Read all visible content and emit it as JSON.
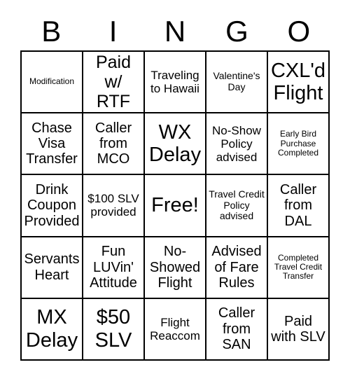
{
  "card": {
    "title": "BINGO",
    "header_letters": [
      "B",
      "I",
      "N",
      "G",
      "O"
    ],
    "columns": 5,
    "rows": 5,
    "border_color": "#000000",
    "background_color": "#ffffff",
    "text_color": "#000000",
    "cells": [
      {
        "text": "Modification",
        "size": "xs",
        "row": 1,
        "col": 1
      },
      {
        "text": "Paid w/ RTF",
        "size": "xl",
        "row": 1,
        "col": 2
      },
      {
        "text": "Traveling to Hawaii",
        "size": "m",
        "row": 1,
        "col": 3
      },
      {
        "text": "Valentine's Day",
        "size": "s",
        "row": 1,
        "col": 4
      },
      {
        "text": "CXL'd Flight",
        "size": "xxl",
        "row": 1,
        "col": 5
      },
      {
        "text": "Chase Visa Transfer",
        "size": "l",
        "row": 2,
        "col": 1
      },
      {
        "text": "Caller from MCO",
        "size": "l",
        "row": 2,
        "col": 2
      },
      {
        "text": "WX Delay",
        "size": "xxl",
        "row": 2,
        "col": 3
      },
      {
        "text": "No-Show Policy advised",
        "size": "m",
        "row": 2,
        "col": 4
      },
      {
        "text": "Early Bird Purchase Completed",
        "size": "xs",
        "row": 2,
        "col": 5
      },
      {
        "text": "Drink Coupon Provided",
        "size": "l",
        "row": 3,
        "col": 1
      },
      {
        "text": "$100 SLV provided",
        "size": "m",
        "row": 3,
        "col": 2
      },
      {
        "text": "Free!",
        "size": "xxl",
        "row": 3,
        "col": 3
      },
      {
        "text": "Travel Credit Policy advised",
        "size": "s",
        "row": 3,
        "col": 4
      },
      {
        "text": "Caller from DAL",
        "size": "l",
        "row": 3,
        "col": 5
      },
      {
        "text": "Servants Heart",
        "size": "l",
        "row": 4,
        "col": 1
      },
      {
        "text": "Fun LUVin' Attitude",
        "size": "l",
        "row": 4,
        "col": 2
      },
      {
        "text": "No-Showed Flight",
        "size": "l",
        "row": 4,
        "col": 3
      },
      {
        "text": "Advised of Fare Rules",
        "size": "l",
        "row": 4,
        "col": 4
      },
      {
        "text": "Completed Travel Credit Transfer",
        "size": "xs",
        "row": 4,
        "col": 5
      },
      {
        "text": "MX Delay",
        "size": "xxl",
        "row": 5,
        "col": 1
      },
      {
        "text": "$50 SLV",
        "size": "xxl",
        "row": 5,
        "col": 2
      },
      {
        "text": "Flight Reaccom",
        "size": "m",
        "row": 5,
        "col": 3
      },
      {
        "text": "Caller from SAN",
        "size": "l",
        "row": 5,
        "col": 4
      },
      {
        "text": "Paid with SLV",
        "size": "l",
        "row": 5,
        "col": 5
      }
    ]
  }
}
